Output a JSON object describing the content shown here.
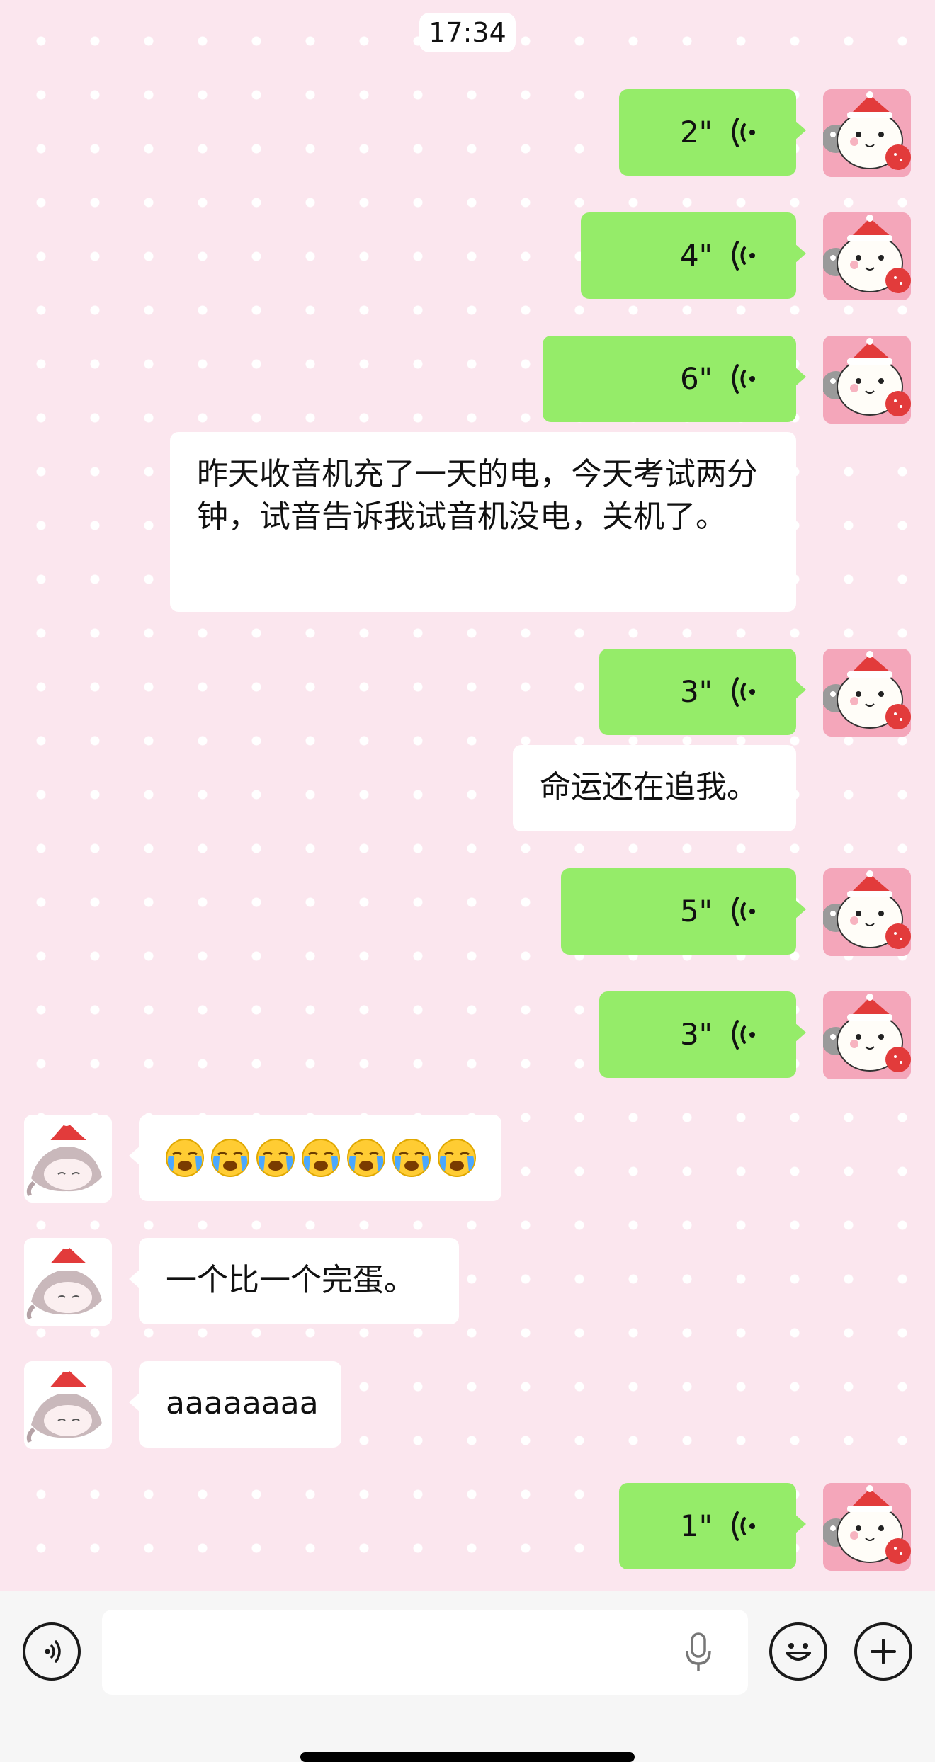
{
  "status": {
    "time": "17:34"
  },
  "messages": [
    {
      "side": "right",
      "type": "voice",
      "duration": "2\""
    },
    {
      "side": "right",
      "type": "voice",
      "duration": "4\""
    },
    {
      "side": "right",
      "type": "voice",
      "duration": "6\""
    },
    {
      "side": "right",
      "type": "text",
      "text": "昨天收音机充了一天的电，今天考试两分钟，试音告诉我试音机没电，关机了。"
    },
    {
      "side": "right",
      "type": "voice",
      "duration": "3\""
    },
    {
      "side": "right",
      "type": "text",
      "text": "命运还在追我。"
    },
    {
      "side": "right",
      "type": "voice",
      "duration": "5\""
    },
    {
      "side": "right",
      "type": "voice",
      "duration": "3\""
    },
    {
      "side": "left",
      "type": "emoji",
      "emoji": "😭😭😭😭😭😭😭"
    },
    {
      "side": "left",
      "type": "text",
      "text": "一个比一个完蛋。"
    },
    {
      "side": "left",
      "type": "text",
      "text": "aaaaaaaa"
    },
    {
      "side": "right",
      "type": "voice",
      "duration": "1\""
    }
  ],
  "input_bar": {
    "left_icon": "voice-mode-icon",
    "mic_icon": "microphone-icon",
    "emoji_icon": "smiley-icon",
    "plus_icon": "plus-icon",
    "input_value": ""
  },
  "colors": {
    "sent_bubble": "#95ec69",
    "received_bubble": "#ffffff",
    "background": "#fbe6ee"
  }
}
